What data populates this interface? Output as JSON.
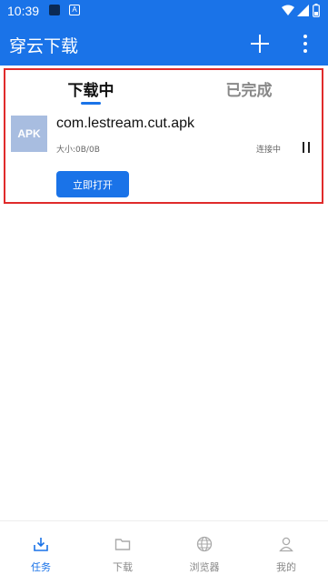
{
  "status_bar": {
    "time": "10:39",
    "notification_letter": "A"
  },
  "app_bar": {
    "title": "穿云下载"
  },
  "tabs": [
    {
      "label": "下载中",
      "active": true
    },
    {
      "label": "已完成",
      "active": false
    }
  ],
  "task": {
    "thumb_label": "APK",
    "file_name": "com.lestream.cut.apk",
    "size": "大小:0B/0B",
    "status": "连接中",
    "open_button": "立即打开"
  },
  "bottom_nav": [
    {
      "label": "任务",
      "icon": "tray-download-icon",
      "active": true
    },
    {
      "label": "下载",
      "icon": "folder-icon",
      "active": false
    },
    {
      "label": "浏览器",
      "icon": "globe-icon",
      "active": false
    },
    {
      "label": "我的",
      "icon": "person-icon",
      "active": false
    }
  ],
  "colors": {
    "primary": "#1a73e8",
    "highlight_border": "#e02b2b",
    "thumb": "#a8bde0"
  }
}
